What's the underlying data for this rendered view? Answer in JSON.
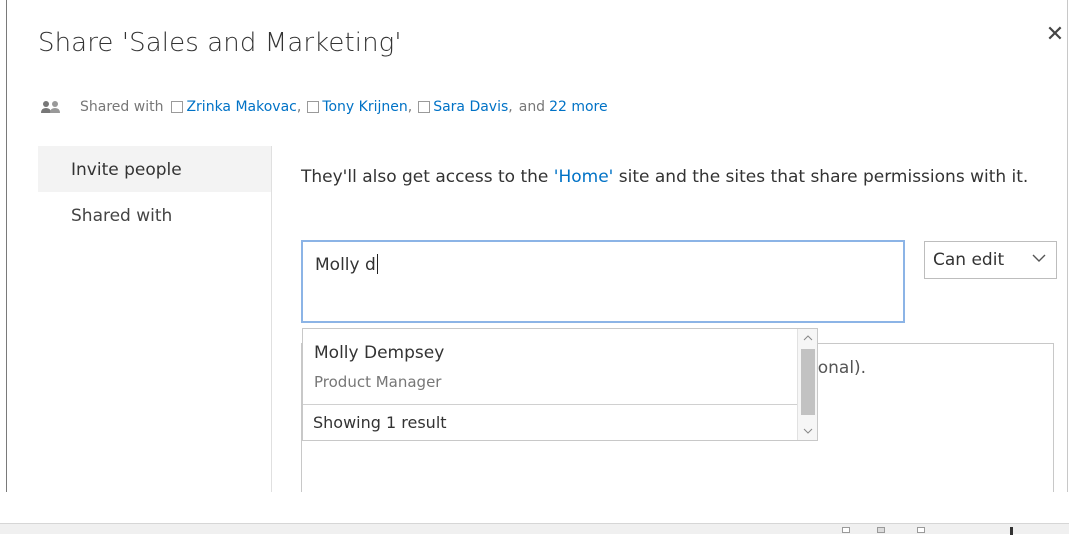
{
  "dialog": {
    "title": "Share 'Sales and Marketing'",
    "close_glyph": "✕"
  },
  "shared_with": {
    "label": "Shared with",
    "people": [
      {
        "name": "Zrinka Makovac",
        "sep": ","
      },
      {
        "name": "Tony Krijnen",
        "sep": ","
      },
      {
        "name": "Sara Davis",
        "sep": ","
      }
    ],
    "and_label": "and",
    "more_link": "22 more",
    "icon": "people-icon"
  },
  "nav": {
    "items": [
      {
        "label": "Invite people",
        "active": true
      },
      {
        "label": "Shared with",
        "active": false
      }
    ]
  },
  "invite": {
    "desc_prefix": "They'll also get access to the ",
    "desc_link": "'Home'",
    "desc_suffix": " site and the sites that share permissions with it.",
    "name_value": "Molly d",
    "permission": "Can edit",
    "message_hint": "ional)."
  },
  "suggestions": {
    "items": [
      {
        "name": "Molly Dempsey",
        "role": "Product Manager"
      }
    ],
    "count_label": "Showing 1 result"
  },
  "colors": {
    "link": "#0072c6",
    "input_focus_border": "#8cb4e6",
    "nav_active_bg": "#f3f3f3"
  }
}
